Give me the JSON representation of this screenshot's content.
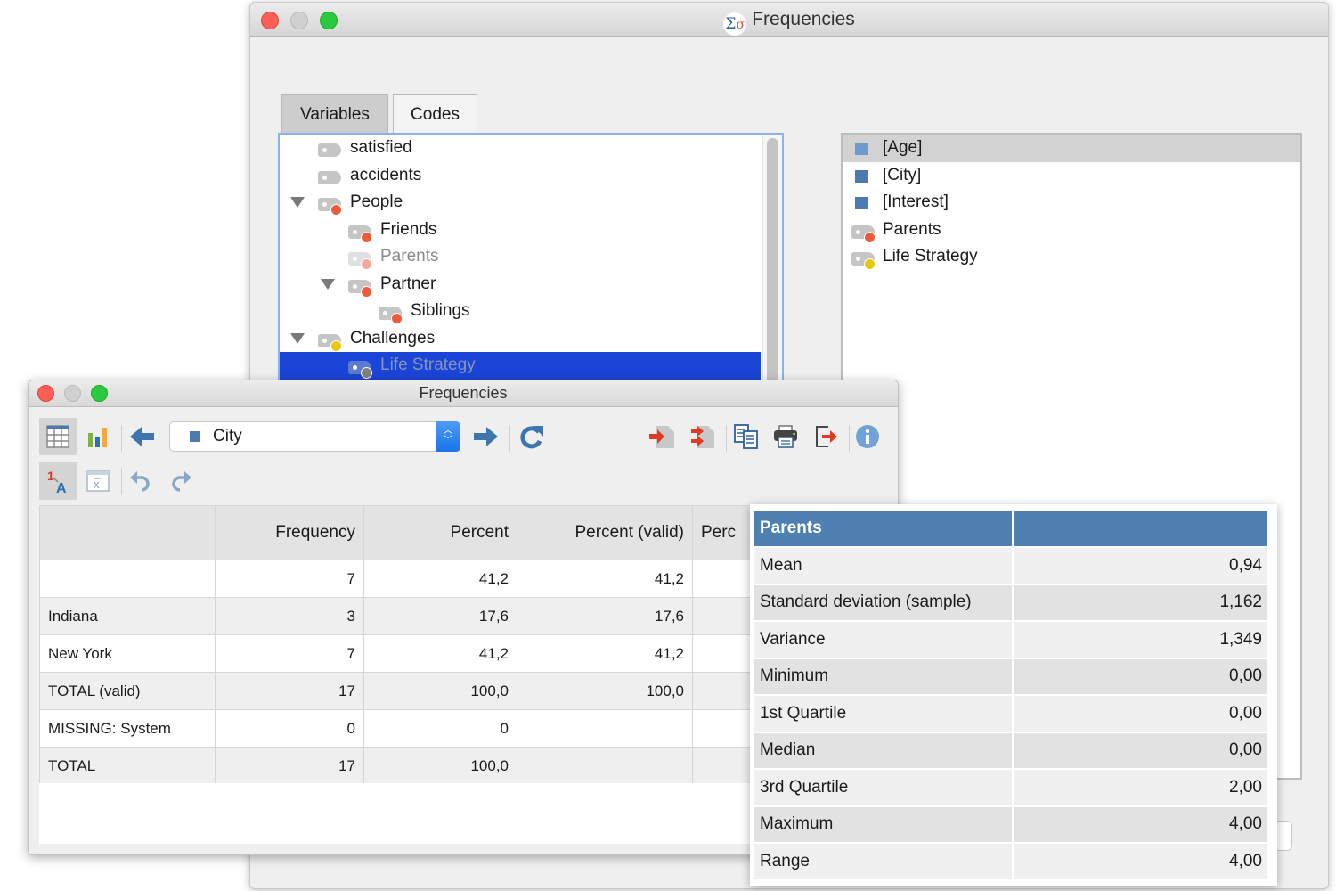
{
  "back_window": {
    "title": "Frequencies",
    "app_icon": "sigma-icon",
    "tabs": [
      {
        "label": "Variables",
        "active": false
      },
      {
        "label": "Codes",
        "active": true
      }
    ],
    "tree": [
      {
        "label": "satisfied",
        "level": 0,
        "expander": false,
        "dot_color": null,
        "state": "normal"
      },
      {
        "label": "accidents",
        "level": 0,
        "expander": false,
        "dot_color": null,
        "state": "normal"
      },
      {
        "label": "People",
        "level": 0,
        "expander": true,
        "dot_color": "#ee5a3c",
        "state": "normal"
      },
      {
        "label": "Friends",
        "level": 1,
        "expander": false,
        "dot_color": "#ee5a3c",
        "state": "normal"
      },
      {
        "label": "Parents",
        "level": 1,
        "expander": false,
        "dot_color": "#f4a89a",
        "state": "dimmed"
      },
      {
        "label": "Partner",
        "level": 1,
        "expander": true,
        "dot_color": "#ee5a3c",
        "state": "normal"
      },
      {
        "label": "Siblings",
        "level": 2,
        "expander": false,
        "dot_color": "#ee5a3c",
        "state": "normal"
      },
      {
        "label": "Challenges",
        "level": 0,
        "expander": true,
        "dot_color": "#e6c80e",
        "state": "normal"
      },
      {
        "label": "Life Strategy",
        "level": 1,
        "expander": false,
        "dot_color": "#808080",
        "state": "selected"
      }
    ],
    "selected_items": [
      {
        "label": "[Age]",
        "type": "variable",
        "highlighted": true
      },
      {
        "label": "[City]",
        "type": "variable",
        "highlighted": false
      },
      {
        "label": "[Interest]",
        "type": "variable",
        "highlighted": false
      },
      {
        "label": "Parents",
        "type": "code",
        "dot_color": "#ee5a3c",
        "highlighted": false
      },
      {
        "label": "Life Strategy",
        "type": "code",
        "dot_color": "#e6c80e",
        "highlighted": false
      }
    ]
  },
  "front_window": {
    "title": "Frequencies",
    "toolbar": {
      "table_view": "table-icon",
      "chart_view": "bar-chart-icon",
      "prev": "arrow-left-icon",
      "variable_select": {
        "value": "City"
      },
      "next": "arrow-right-icon",
      "refresh": "refresh-icon",
      "import_one": "import-icon",
      "import_multi": "import-multiple-icon",
      "copy": "copy-icon",
      "print": "print-icon",
      "export": "export-icon",
      "info": "info-icon",
      "sort": "sort-numeric-alpha-icon",
      "statistics": "statistics-icon",
      "undo": "undo-icon",
      "redo": "redo-icon"
    },
    "table": {
      "headers": [
        "",
        "Frequency",
        "Percent",
        "Percent (valid)",
        "Perc"
      ],
      "rows": [
        [
          "",
          "7",
          "41,2",
          "41,2",
          ""
        ],
        [
          "Indiana",
          "3",
          "17,6",
          "17,6",
          ""
        ],
        [
          "New York",
          "7",
          "41,2",
          "41,2",
          ""
        ],
        [
          "TOTAL (valid)",
          "17",
          "100,0",
          "100,0",
          ""
        ],
        [
          "MISSING: System",
          "0",
          "0",
          "",
          ""
        ],
        [
          "TOTAL",
          "17",
          "100,0",
          "",
          ""
        ]
      ]
    }
  },
  "stats": {
    "header": [
      "Parents",
      ""
    ],
    "rows": [
      {
        "label": "Mean",
        "value": "0,94"
      },
      {
        "label": "Standard deviation (sample)",
        "value": "1,162"
      },
      {
        "label": "Variance",
        "value": "1,349"
      },
      {
        "label": "Minimum",
        "value": "0,00"
      },
      {
        "label": "1st Quartile",
        "value": "0,00"
      },
      {
        "label": "Median",
        "value": "0,00"
      },
      {
        "label": "3rd Quartile",
        "value": "2,00"
      },
      {
        "label": "Maximum",
        "value": "4,00"
      },
      {
        "label": "Range",
        "value": "4,00"
      }
    ]
  }
}
